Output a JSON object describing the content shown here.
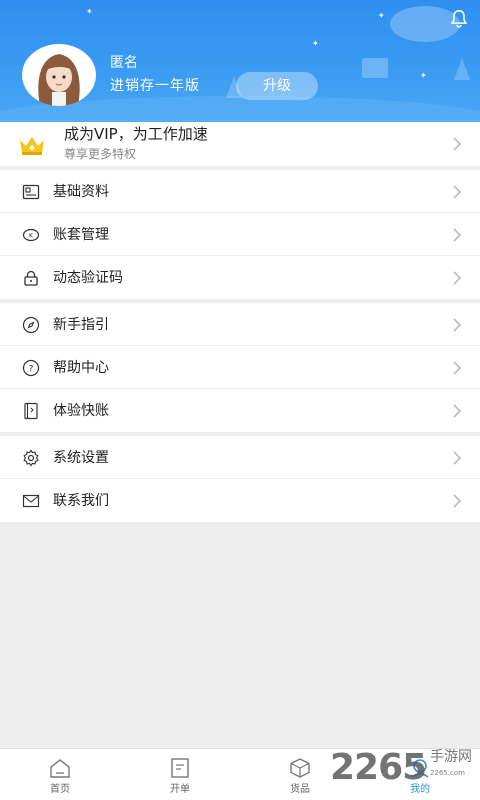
{
  "header": {
    "user_name": "匿名",
    "plan": "进销存一年版",
    "upgrade_label": "升级"
  },
  "vip": {
    "title": "成为VIP，为工作加速",
    "subtitle": "尊享更多特权"
  },
  "menu_groups": [
    [
      {
        "label": "基础资料",
        "icon": "id-card-icon"
      },
      {
        "label": "账套管理",
        "icon": "ledger-coin-icon"
      },
      {
        "label": "动态验证码",
        "icon": "lock-icon"
      }
    ],
    [
      {
        "label": "新手指引",
        "icon": "compass-icon"
      },
      {
        "label": "帮助中心",
        "icon": "help-icon"
      },
      {
        "label": "体验快账",
        "icon": "book-icon"
      }
    ],
    [
      {
        "label": "系统设置",
        "icon": "gear-icon"
      },
      {
        "label": "联系我们",
        "icon": "mail-icon"
      }
    ]
  ],
  "tabs": [
    {
      "label": "首页",
      "icon": "home-icon",
      "active": false
    },
    {
      "label": "开单",
      "icon": "document-icon",
      "active": false
    },
    {
      "label": "货品",
      "icon": "box-icon",
      "active": false
    },
    {
      "label": "我的",
      "icon": "profile-icon",
      "active": true
    }
  ],
  "watermark": {
    "number": "2265",
    "text": "手游网",
    "url": "2265.com"
  },
  "colors": {
    "brand_blue": "#2f8ff0",
    "vip_gold": "#f5c518"
  }
}
